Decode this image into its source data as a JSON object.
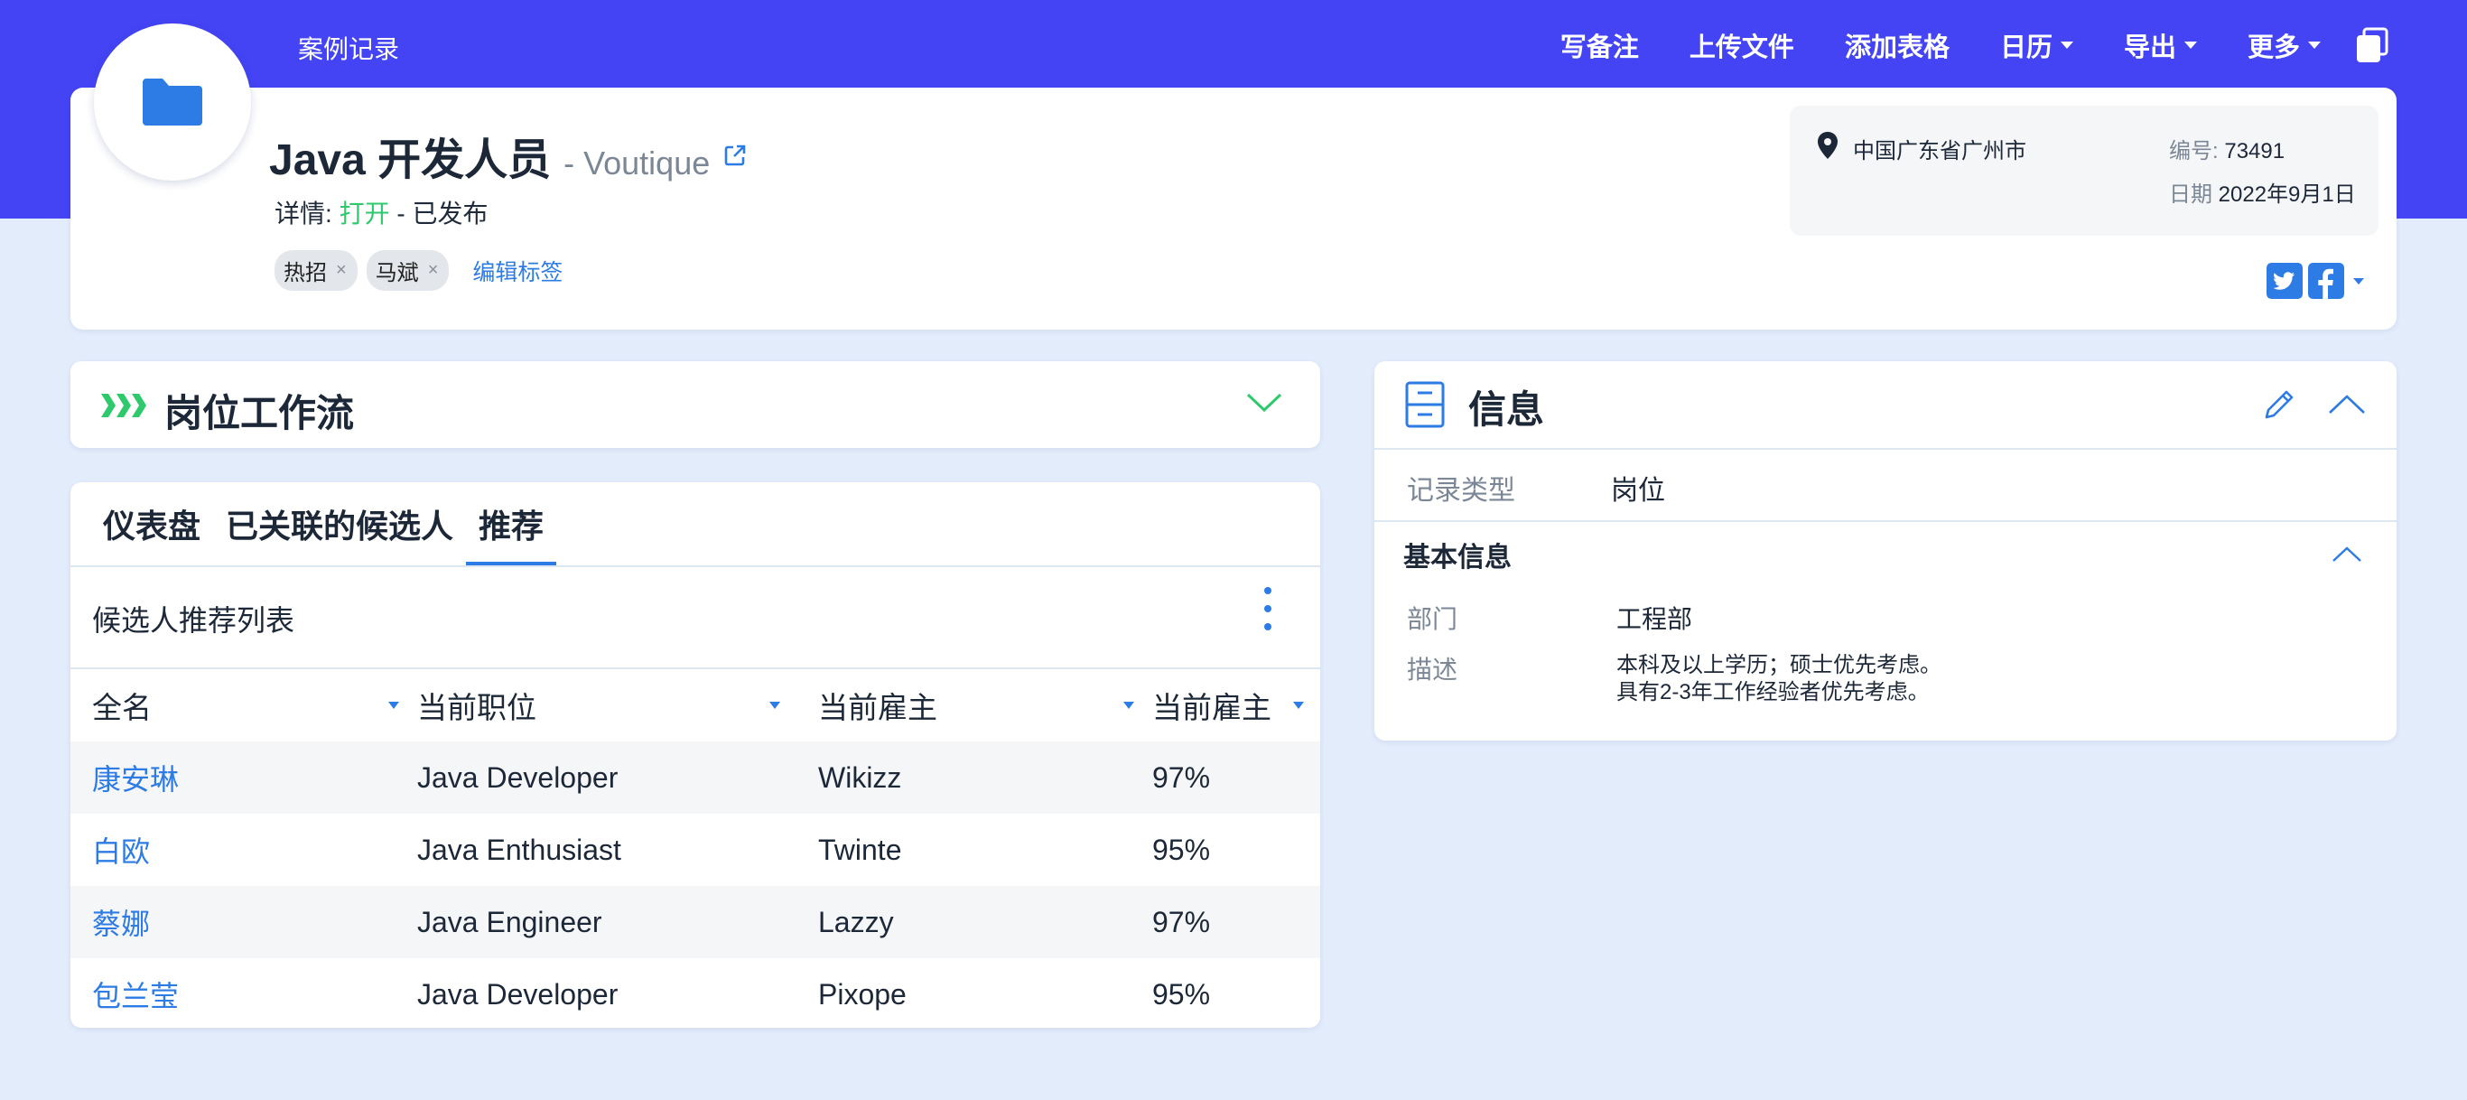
{
  "breadcrumb": "案例记录",
  "nav": {
    "items": [
      {
        "label": "写备注",
        "dropdown": false
      },
      {
        "label": "上传文件",
        "dropdown": false
      },
      {
        "label": "添加表格",
        "dropdown": false
      },
      {
        "label": "日历",
        "dropdown": true
      },
      {
        "label": "导出",
        "dropdown": true
      },
      {
        "label": "更多",
        "dropdown": true
      }
    ]
  },
  "header": {
    "title": "Java 开发人员",
    "company": "- Voutique",
    "detail_label": "详情:",
    "status_open": "打开",
    "status_rest": "- 已发布",
    "tags": [
      "热招",
      "马斌"
    ],
    "tag_remove": "×",
    "edit_tags": "编辑标签"
  },
  "location": {
    "address": "中国广东省广州市",
    "id_label": "编号:",
    "id_value": "73491",
    "date_label": "日期",
    "date_value": "2022年9月1日"
  },
  "workflow": {
    "title": "岗位工作流"
  },
  "tabs": {
    "items": [
      "仪表盘",
      "已关联的候选人",
      "推荐"
    ],
    "active_index": 2
  },
  "list": {
    "title": "候选人推荐列表",
    "columns": [
      "全名",
      "当前职位",
      "当前雇主",
      "当前雇主"
    ],
    "rows": [
      {
        "name": "康安琳",
        "position": "Java Developer",
        "employer": "Wikizz",
        "match": "97%"
      },
      {
        "name": "白欧",
        "position": "Java Enthusiast",
        "employer": "Twinte",
        "match": "95%"
      },
      {
        "name": "蔡娜",
        "position": "Java Engineer",
        "employer": "Lazzy",
        "match": "97%"
      },
      {
        "name": "包兰莹",
        "position": "Java Developer",
        "employer": "Pixope",
        "match": "95%"
      }
    ]
  },
  "info": {
    "title": "信息",
    "record_type_label": "记录类型",
    "record_type_value": "岗位",
    "basic_title": "基本信息",
    "dept_label": "部门",
    "dept_value": "工程部",
    "desc_label": "描述",
    "desc_line1": "本科及以上学历；硕士优先考虑。",
    "desc_line2": "具有2-3年工作经验者优先考虑。"
  },
  "colors": {
    "topbar": "#4444f5",
    "accent": "#2d7be5",
    "success": "#2fc96d",
    "background": "#e2ecfb"
  },
  "icons": [
    "folder-icon",
    "external-link-icon",
    "copy-icon",
    "location-pin-icon",
    "twitter-icon",
    "facebook-icon",
    "workflow-arrows-icon",
    "chevron-down-icon",
    "archive-box-icon",
    "pencil-icon",
    "chevron-up-icon",
    "kebab-menu-icon"
  ]
}
